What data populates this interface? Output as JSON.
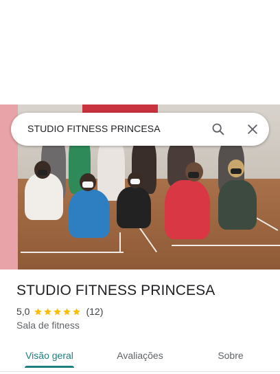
{
  "search": {
    "query": "STUDIO FITNESS PRINCESA",
    "search_icon": "search-icon",
    "close_icon": "close-icon"
  },
  "place": {
    "name": "STUDIO FITNESS PRINCESA",
    "rating": "5,0",
    "stars": 5,
    "review_count": "(12)",
    "category": "Sala de fitness"
  },
  "tabs": [
    {
      "label": "Visão geral",
      "active": true
    },
    {
      "label": "Avaliações",
      "active": false
    },
    {
      "label": "Sobre",
      "active": false
    }
  ],
  "colors": {
    "accent": "#1a7f80",
    "star": "#fbbc04"
  }
}
